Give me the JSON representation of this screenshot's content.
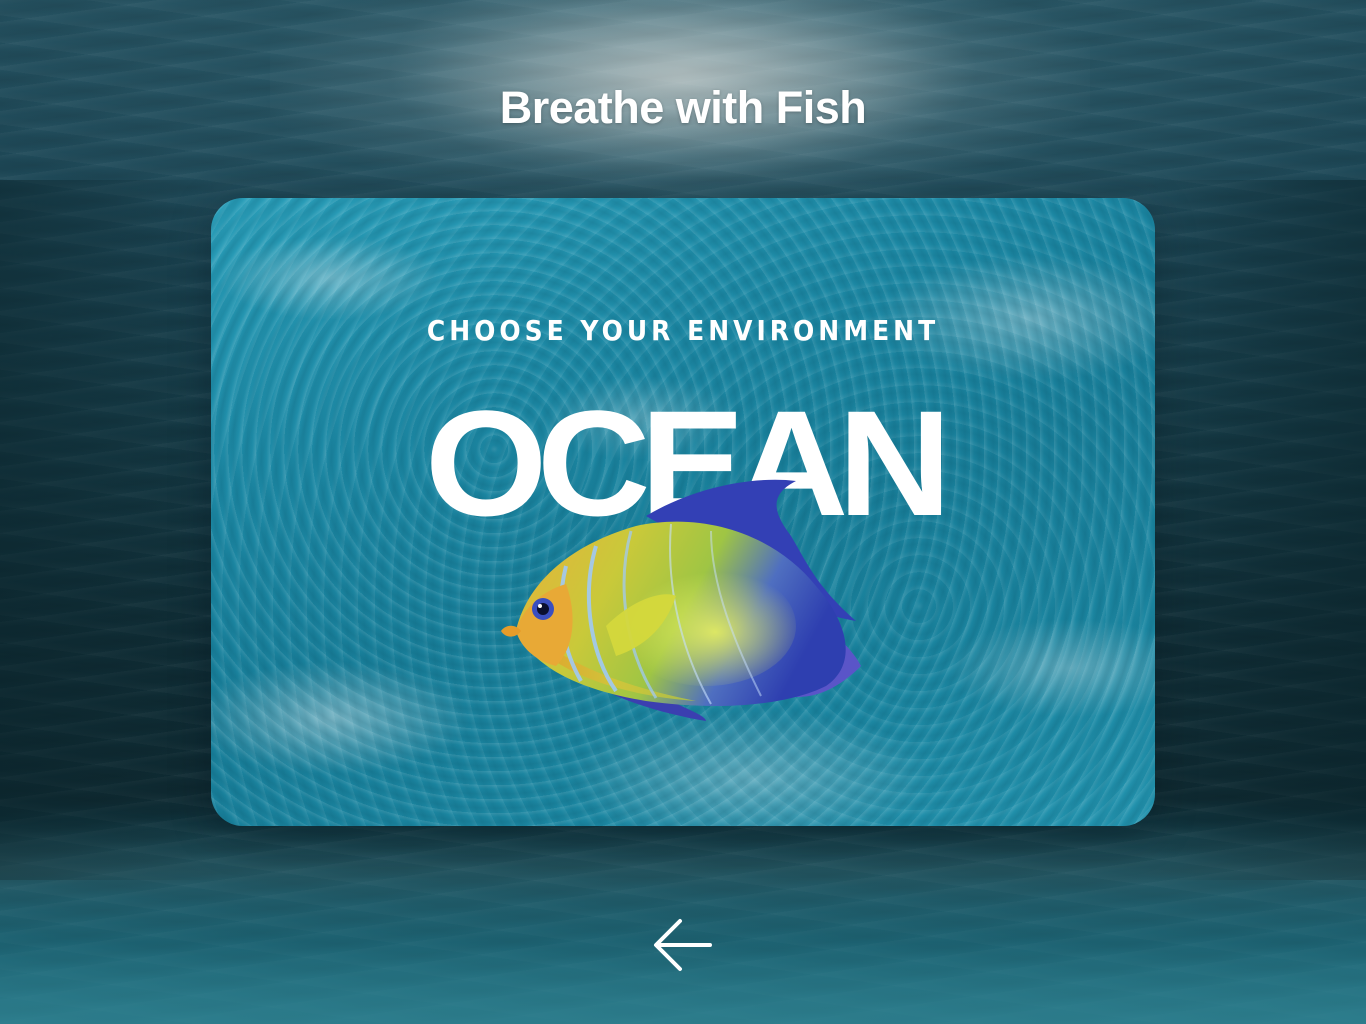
{
  "app": {
    "title": "Breathe with Fish"
  },
  "card": {
    "subtitle": "CHOOSE YOUR ENVIRONMENT",
    "heading": "OCEAN",
    "image": "angelfish-over-ocean-waves"
  },
  "navigation": {
    "back_icon": "arrow-left-icon"
  },
  "colors": {
    "text": "#ffffff",
    "water_deep": "#102e37",
    "water_card": "#1d8aa6"
  }
}
